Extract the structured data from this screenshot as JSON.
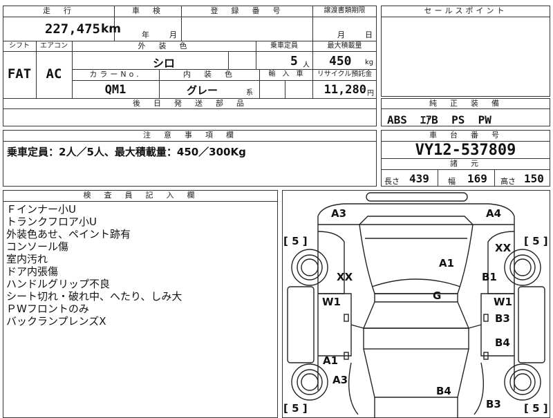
{
  "vehicle_table": {
    "mileage_label": "走　行",
    "mileage_value": "227,475",
    "mileage_unit": "km",
    "inspection_label": "車　検",
    "inspection_year_unit": "年",
    "inspection_month_unit": "月",
    "registration_label": "登　録　番　号",
    "transfer_deadline_label": "譲渡書類期限",
    "transfer_month_unit": "月",
    "transfer_day_unit": "日",
    "shift_label": "シフト",
    "aircon_label": "エアコン",
    "exterior_color_label": "外　装　色",
    "capacity_label": "乗車定員",
    "max_load_label": "最大積載量",
    "shift_value": "FAT",
    "aircon_value": "AC",
    "exterior_color_value": "シロ",
    "capacity_value": "5",
    "capacity_unit": "人",
    "max_load_value": "450",
    "max_load_unit": "kg",
    "color_no_label": "カラーNo.",
    "interior_color_label": "内　装　色",
    "import_label": "輸　入　車",
    "recycle_label": "リサイクル預託金",
    "color_no_value": "QM1",
    "interior_color_value": "グレー",
    "interior_color_suffix": "系",
    "recycle_value": "11,280",
    "recycle_unit": "円",
    "later_parts_label": "後　日　発　送　部　品"
  },
  "sales_point": {
    "label": "セールスポイント"
  },
  "standard_equipment": {
    "label": "純　正　装　備",
    "value": "ABS  ｴｱB  PS  PW"
  },
  "notes": {
    "label": "注　意　事　項　欄",
    "value": "乗車定員：2人／5人、最大積載量：450／300Kg"
  },
  "chassis": {
    "label": "車　台　番　号",
    "value": "VY12-537809",
    "specs_label": "諸　元",
    "length_label": "長さ",
    "length_value": "439",
    "width_label": "幅",
    "width_value": "169",
    "height_label": "高さ",
    "height_value": "150"
  },
  "inspector": {
    "label": "検　査　員　記　入　欄",
    "lines": [
      "Ｆインナー小U",
      "トランクフロア小U",
      "外装色あせ、ペイント跡有",
      "コンソール傷",
      "室内汚れ",
      "ドア内張傷",
      "ハンドルグリップ不良",
      "シート切れ・破れ中、へたり、しみ大",
      "ＰWフロントのみ",
      "バックランプレンズX"
    ]
  },
  "diagram": {
    "marks": {
      "front_left_corner": "A3",
      "front_right_corner": "A4",
      "tire_front_left": "[ 5 ]",
      "tire_front_right": "[ 5 ]",
      "tire_rear_left": "[ 5 ]",
      "tire_rear_right": "[ 5 ]",
      "front_right_fender": "XX",
      "front_left_fender": "XX",
      "hood": "A1",
      "right_fender_b1": "B1",
      "windshield": "G",
      "left_front_door": "W1",
      "right_front_door": "W1",
      "right_front_door_b3": "B3",
      "right_rear_door": "B4",
      "left_rear_door": "A1",
      "left_rear_quarter": "A3",
      "rear": "B4",
      "right_rear_quarter": "B3"
    }
  }
}
